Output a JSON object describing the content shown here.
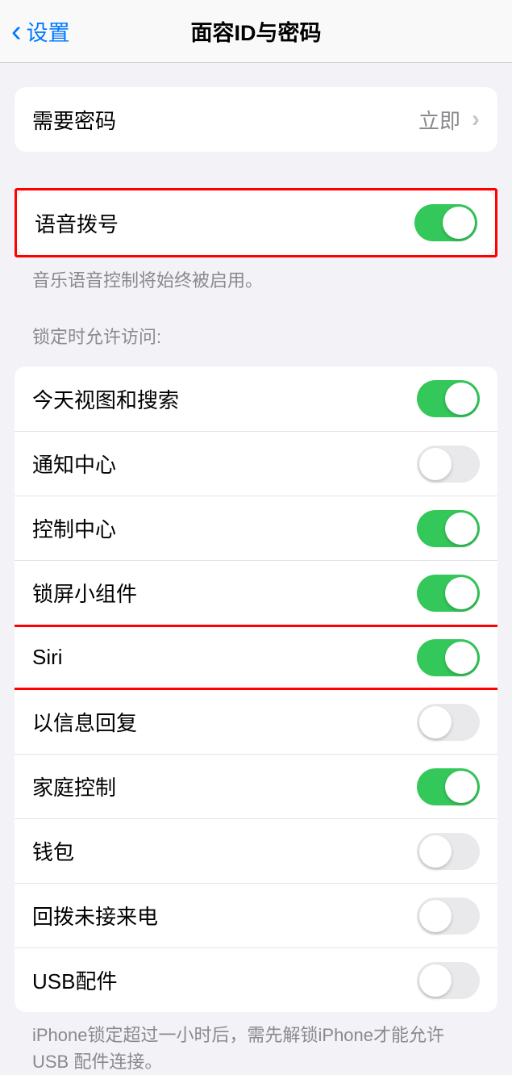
{
  "header": {
    "back_label": "设置",
    "title": "面容ID与密码"
  },
  "require_passcode": {
    "label": "需要密码",
    "value": "立即"
  },
  "voice_dial": {
    "label": "语音拨号",
    "on": true,
    "highlighted": true,
    "footer": "音乐语音控制将始终被启用。"
  },
  "lock_access": {
    "header": "锁定时允许访问:",
    "items": [
      {
        "label": "今天视图和搜索",
        "on": true,
        "highlighted": false
      },
      {
        "label": "通知中心",
        "on": false,
        "highlighted": false
      },
      {
        "label": "控制中心",
        "on": true,
        "highlighted": false
      },
      {
        "label": "锁屏小组件",
        "on": true,
        "highlighted": false
      },
      {
        "label": "Siri",
        "on": true,
        "highlighted": true
      },
      {
        "label": "以信息回复",
        "on": false,
        "highlighted": false
      },
      {
        "label": "家庭控制",
        "on": true,
        "highlighted": false
      },
      {
        "label": "钱包",
        "on": false,
        "highlighted": false
      },
      {
        "label": "回拨未接来电",
        "on": false,
        "highlighted": false
      },
      {
        "label": "USB配件",
        "on": false,
        "highlighted": false
      }
    ],
    "footer": "iPhone锁定超过一小时后，需先解锁iPhone才能允许USB 配件连接。"
  }
}
